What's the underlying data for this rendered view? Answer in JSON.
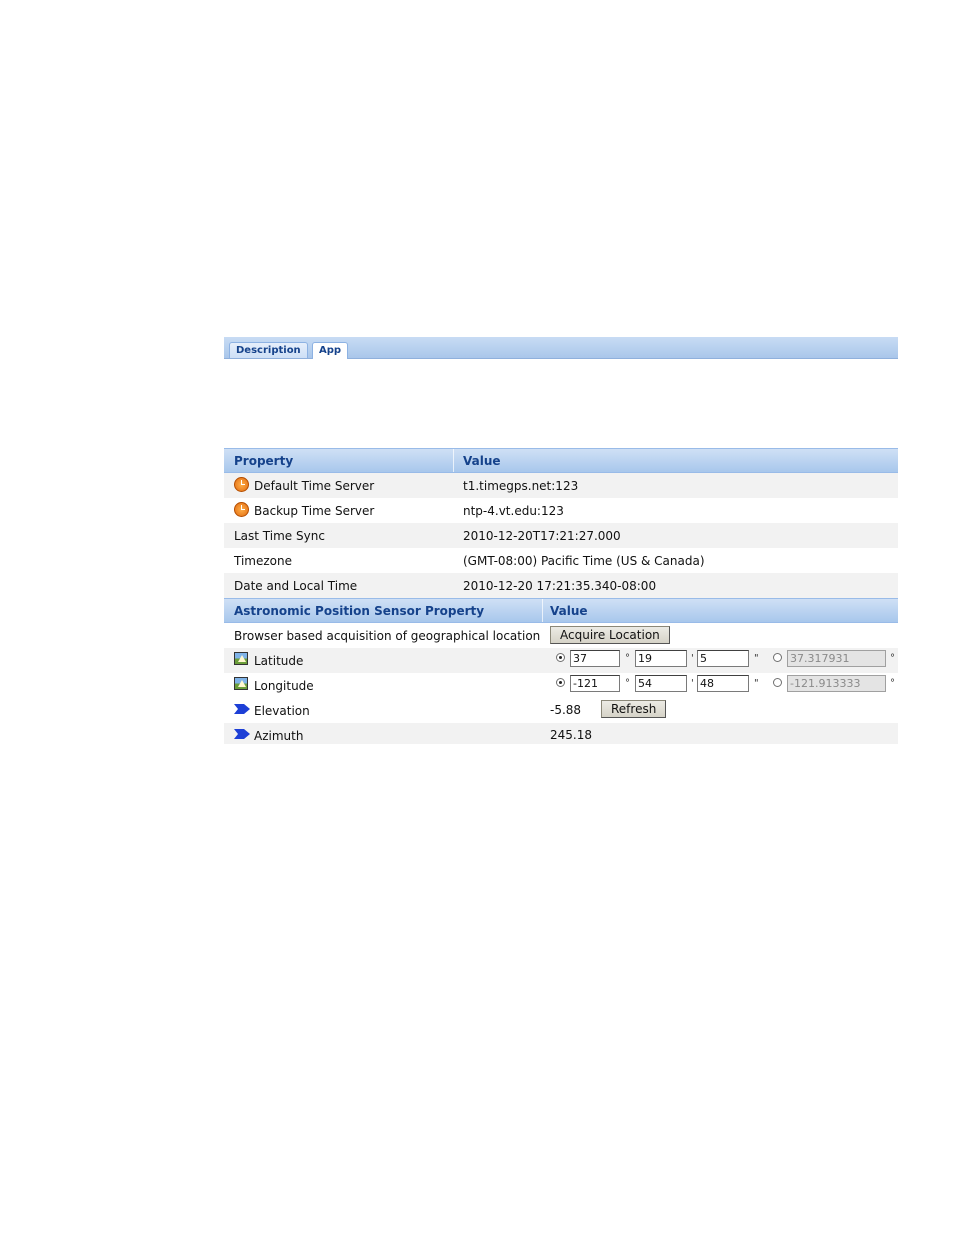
{
  "tabs": [
    {
      "label": "Description",
      "active": false
    },
    {
      "label": "App",
      "active": true
    }
  ],
  "time_table": {
    "headers": {
      "property": "Property",
      "value": "Value"
    },
    "rows": [
      {
        "property": "Default Time Server",
        "value": "t1.timegps.net:123",
        "icon": "clock-icon"
      },
      {
        "property": "Backup Time Server",
        "value": "ntp-4.vt.edu:123",
        "icon": "clock-icon"
      },
      {
        "property": "Last Time Sync",
        "value": "2010-12-20T17:21:27.000"
      },
      {
        "property": "Timezone",
        "value": "(GMT-08:00) Pacific Time (US & Canada)"
      },
      {
        "property": "Date and Local Time",
        "value": "2010-12-20 17:21:35.340-08:00"
      }
    ]
  },
  "sensor_table": {
    "headers": {
      "property": "Astronomic Position Sensor Property",
      "value": "Value"
    },
    "acquire": {
      "property": "Browser based acquisition of geographical location",
      "button": "Acquire Location"
    },
    "latitude": {
      "property": "Latitude",
      "deg": "37",
      "min": "19",
      "sec": "5",
      "decimal": "37.317931",
      "selected": "dms"
    },
    "longitude": {
      "property": "Longitude",
      "deg": "-121",
      "min": "54",
      "sec": "48",
      "decimal": "-121.913333",
      "selected": "dms"
    },
    "elevation": {
      "property": "Elevation",
      "value": "-5.88",
      "button": "Refresh"
    },
    "azimuth": {
      "property": "Azimuth",
      "value": "245.18"
    },
    "units": {
      "deg": "°",
      "min": "'",
      "sec": "\""
    }
  },
  "colors": {
    "header_text": "#15428b",
    "header_bg": "#a8c7ec",
    "alt_row": "#f2f2f2"
  }
}
